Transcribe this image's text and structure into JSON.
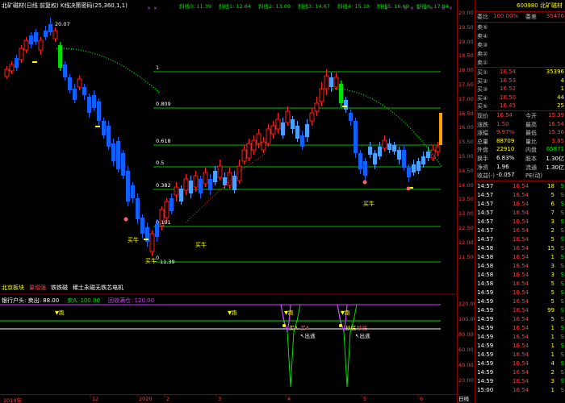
{
  "header": {
    "title": "北矿磁材(日线 前复权) K线决策密码(25,360,1,1)",
    "lines": [
      {
        "text": "斜线0: 11.39",
        "color": "#00e000"
      },
      {
        "text": "斜线1: 12.64",
        "color": "#00e000"
      },
      {
        "text": "斜线2: 13.09",
        "color": "#00e000"
      },
      {
        "text": "斜线3: 14.67",
        "color": "#00e000"
      },
      {
        "text": "斜线4: 15.18",
        "color": "#00e000"
      },
      {
        "text": "斜线5: 16.69",
        "color": "#00e000"
      },
      {
        "text": "斜线6: 17.94",
        "color": "#00e000"
      }
    ]
  },
  "chart_labels": {
    "high_price": "20.07",
    "low_price": "11.39",
    "fib": [
      "1",
      "0.809",
      "0.618",
      "0.5",
      "0.382",
      "0.191",
      "0"
    ],
    "buy_tags": [
      "买牛",
      "买牛",
      "买牛",
      "买牛",
      "买牛"
    ]
  },
  "price_axis": [
    "20.00",
    "19.50",
    "19.00",
    "18.50",
    "18.00",
    "17.50",
    "17.00",
    "16.50",
    "16.00",
    "15.50",
    "15.00",
    "14.50",
    "14.00",
    "13.50",
    "13.00",
    "12.50",
    "12.00",
    "11.50"
  ],
  "sector": {
    "items": [
      {
        "text": "北京板块",
        "color": "#ffff00"
      },
      {
        "text": "量增强",
        "color": "#ff3b3b"
      },
      {
        "text": "铁铁磁",
        "color": "#ffffff"
      },
      {
        "text": "稀土永磁无铁芯电机",
        "color": "#ffffff"
      }
    ]
  },
  "indicator": {
    "header": [
      {
        "text": "银行户头: 卖出: 88.00",
        "color": "#ffffff"
      },
      {
        "text": "卖A: 100.00",
        "color": "#00e000"
      },
      {
        "text": "回收满仓: 120.00",
        "color": "#d040ff"
      }
    ],
    "axis": [
      "120.00",
      "100.00",
      "80.00",
      "60.00",
      "40.00",
      "20.00"
    ],
    "tags_run": [
      "跑",
      "跑",
      "跑",
      "跑"
    ],
    "tags_out": [
      "出逃",
      "出逃"
    ],
    "tags_buy": [
      "买A",
      "买A",
      "抄底",
      "抄底"
    ]
  },
  "x_axis": {
    "ticks": [
      "2019年",
      "12",
      "2020",
      "2",
      "3",
      "4",
      "5",
      "6"
    ],
    "period": "日线"
  },
  "panel": {
    "code": "600980",
    "name": "北矿磁材",
    "weibi_label": "委比",
    "weibi_value": "100.00%",
    "weicha_label": "委差",
    "weicha_value": "35476",
    "sells": [
      {
        "label": "卖⑤",
        "price": "",
        "vol": ""
      },
      {
        "label": "卖④",
        "price": "",
        "vol": ""
      },
      {
        "label": "卖③",
        "price": "",
        "vol": ""
      },
      {
        "label": "卖②",
        "price": "",
        "vol": ""
      },
      {
        "label": "卖①",
        "price": "",
        "vol": ""
      }
    ],
    "buys": [
      {
        "label": "买①",
        "price": "16.54",
        "vol": "35396"
      },
      {
        "label": "买②",
        "price": "16.53",
        "vol": "4"
      },
      {
        "label": "买③",
        "price": "16.52",
        "vol": "1"
      },
      {
        "label": "买④",
        "price": "16.50",
        "vol": "44"
      },
      {
        "label": "买⑤",
        "price": "16.45",
        "vol": "25"
      }
    ],
    "stats": [
      {
        "l1": "现价",
        "v1": "16.54",
        "l2": "今开",
        "v2": "15.39"
      },
      {
        "l1": "涨跌",
        "v1": "1.50",
        "l2": "最高",
        "v2": "16.54"
      },
      {
        "l1": "涨幅",
        "v1": "9.97%",
        "l2": "最低",
        "v2": "15.36"
      },
      {
        "l1": "总量",
        "v1": "88709",
        "l2": "量比",
        "v2": "3.85"
      },
      {
        "l1": "外盘",
        "v1": "22910",
        "l2": "内盘",
        "v2": "65871"
      },
      {
        "l1": "换手",
        "v1": "6.83%",
        "l2": "股本",
        "v2": "1.30亿"
      },
      {
        "l1": "净资",
        "v1": "1.96",
        "l2": "流通",
        "v2": "1.30亿"
      },
      {
        "l1": "收益(-)",
        "v1": "-0.057",
        "l2": "PE(动)",
        "v2": ""
      }
    ],
    "ticks": [
      {
        "t": "14:57",
        "p": "16.54",
        "v": "18",
        "s": "S"
      },
      {
        "t": "14:57",
        "p": "16.54",
        "v": "5",
        "s": "S"
      },
      {
        "t": "14:57",
        "p": "16.54",
        "v": "6",
        "s": "S"
      },
      {
        "t": "14:57",
        "p": "16.54",
        "v": "7",
        "s": "S"
      },
      {
        "t": "14:57",
        "p": "16.54",
        "v": "3",
        "s": "S"
      },
      {
        "t": "14:57",
        "p": "16.54",
        "v": "2",
        "s": "S"
      },
      {
        "t": "14:57",
        "p": "16.54",
        "v": "5",
        "s": "S"
      },
      {
        "t": "14:58",
        "p": "16.54",
        "v": "15",
        "s": "S"
      },
      {
        "t": "14:58",
        "p": "16.54",
        "v": "1",
        "s": "S"
      },
      {
        "t": "14:58",
        "p": "16.54",
        "v": "3",
        "s": "S"
      },
      {
        "t": "14:58",
        "p": "16.54",
        "v": "3",
        "s": "S"
      },
      {
        "t": "14:58",
        "p": "16.54",
        "v": "5",
        "s": "S"
      },
      {
        "t": "14:59",
        "p": "16.54",
        "v": "5",
        "s": "S"
      },
      {
        "t": "14:59",
        "p": "16.54",
        "v": "5",
        "s": "S"
      },
      {
        "t": "14:59",
        "p": "16.54",
        "v": "99",
        "s": "S"
      },
      {
        "t": "14:59",
        "p": "16.54",
        "v": "5",
        "s": "S"
      },
      {
        "t": "14:59",
        "p": "16.54",
        "v": "1",
        "s": "S"
      },
      {
        "t": "14:59",
        "p": "16.54",
        "v": "1",
        "s": "S"
      },
      {
        "t": "14:59",
        "p": "16.54",
        "v": "1",
        "s": "S"
      },
      {
        "t": "14:59",
        "p": "16.54",
        "v": "1",
        "s": "S"
      },
      {
        "t": "14:59",
        "p": "16.54",
        "v": "4",
        "s": "S"
      },
      {
        "t": "14:59",
        "p": "16.54",
        "v": "2",
        "s": "S"
      },
      {
        "t": "14:59",
        "p": "16.54",
        "v": "3",
        "s": "S"
      },
      {
        "t": "15:00",
        "p": "16.54",
        "v": "1",
        "s": "S"
      }
    ]
  },
  "colors": {
    "up": "#ff2020",
    "down": "#1060ff",
    "light_down": "#4aa0ff",
    "fib_line": "#00c000",
    "curve": "#00ff00",
    "yellow": "#ffff00",
    "green": "#00e000",
    "purple": "#d040ff",
    "white": "#ffffff"
  }
}
